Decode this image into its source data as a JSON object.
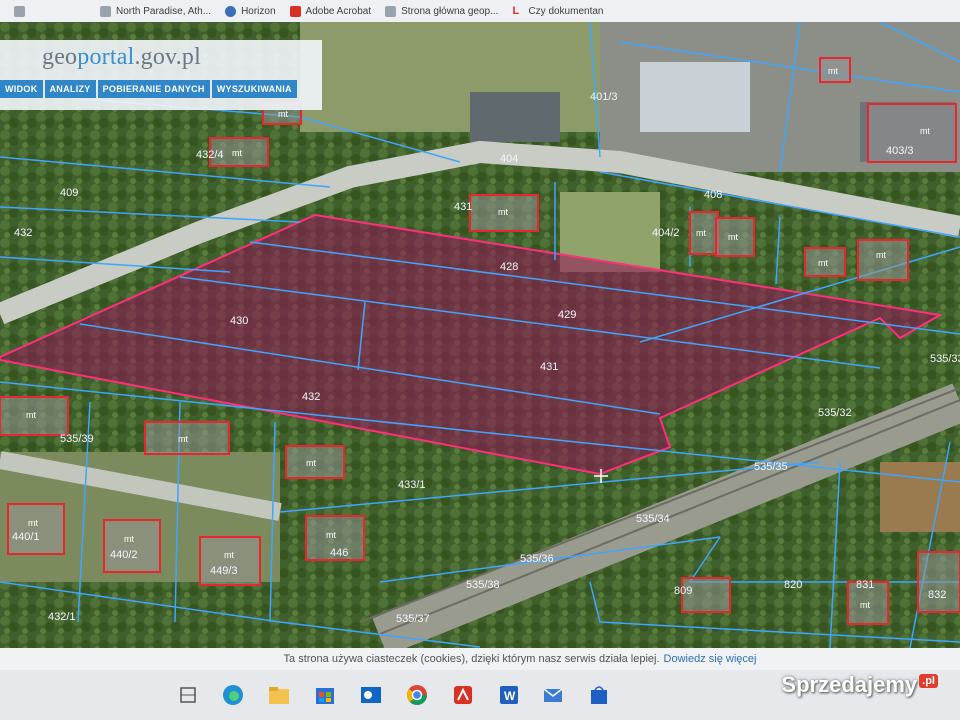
{
  "bookmarks": [
    {
      "label": "",
      "icon": "page-icon",
      "color": "#9aa3ad"
    },
    {
      "label": "North Paradise, Ath...",
      "icon": "page-icon",
      "color": "#9aa3ad"
    },
    {
      "label": "Horizon",
      "icon": "horizon-icon",
      "color": "#3a6fb5"
    },
    {
      "label": "Adobe Acrobat",
      "icon": "acrobat-icon",
      "color": "#d93025"
    },
    {
      "label": "Strona główna geop...",
      "icon": "geoportal-icon",
      "color": "#9aa3ad"
    },
    {
      "label": "Czy dokumentan",
      "icon": "l-icon",
      "color": "#d93025"
    }
  ],
  "geoportal": {
    "logo_geo": "geo",
    "logo_portal": "portal",
    "logo_domain": ".gov.pl",
    "nav": [
      "WIDOK",
      "ANALIZY",
      "POBIERANIE DANYCH",
      "WYSZUKIWANIA"
    ]
  },
  "map": {
    "parcel_labels": [
      "428",
      "429",
      "430",
      "431",
      "432",
      "431",
      "432/4",
      "401/3",
      "404/2",
      "408",
      "409",
      "404",
      "403/3",
      "432",
      "433/1",
      "535/33",
      "535/34",
      "535/35",
      "535/36",
      "535/37",
      "535/38",
      "535/39",
      "535/32",
      "432/1",
      "809",
      "820",
      "831",
      "832",
      "440/1",
      "440/2",
      "446",
      "449/3"
    ],
    "building_labels": [
      "mt",
      "mt",
      "mt",
      "mt",
      "mt",
      "mt",
      "mt",
      "mt",
      "mt",
      "mt",
      "mt",
      "mt",
      "mt",
      "mt",
      "mt",
      "mt",
      "mt"
    ],
    "highlight_color": "#ff2f7a",
    "parcel_line_color": "#3fa5ff",
    "building_outline_color": "#e8262e"
  },
  "cookie": {
    "text": "Ta strona używa ciasteczek (cookies), dzięki którym nasz serwis działa lepiej.",
    "link": "Dowiedz się więcej"
  },
  "taskbar": {
    "icons": [
      "widgets-icon",
      "edge-icon",
      "file-explorer-icon",
      "store-icon",
      "outlook-icon",
      "chrome-icon",
      "acrobat-icon",
      "word-icon",
      "mail-icon",
      "store-bag-icon"
    ]
  },
  "watermark": {
    "text": "Sprzedajemy",
    "suffix": ".pl"
  }
}
